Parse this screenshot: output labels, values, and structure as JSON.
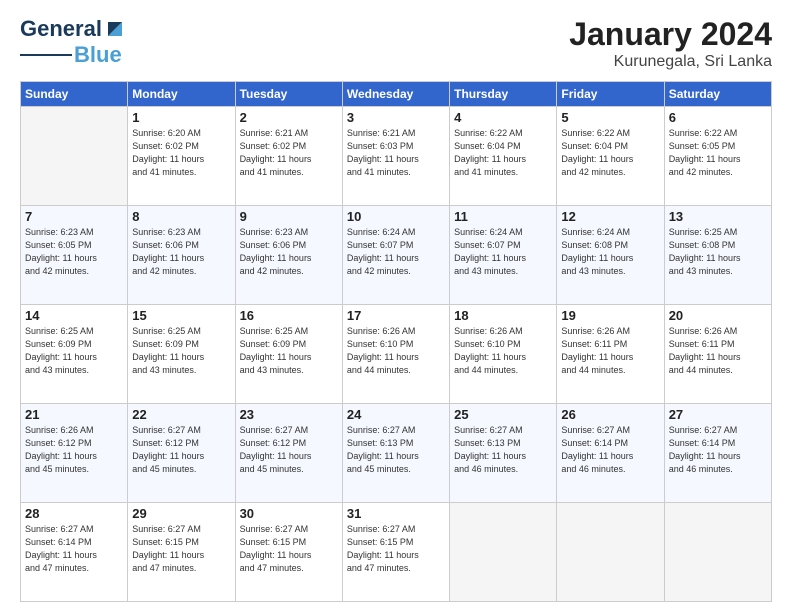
{
  "logo": {
    "part1": "General",
    "part2": "Blue"
  },
  "title": "January 2024",
  "subtitle": "Kurunegala, Sri Lanka",
  "days_of_week": [
    "Sunday",
    "Monday",
    "Tuesday",
    "Wednesday",
    "Thursday",
    "Friday",
    "Saturday"
  ],
  "weeks": [
    [
      {
        "day": "",
        "sunrise": "",
        "sunset": "",
        "daylight": ""
      },
      {
        "day": "1",
        "sunrise": "Sunrise: 6:20 AM",
        "sunset": "Sunset: 6:02 PM",
        "daylight": "Daylight: 11 hours and 41 minutes."
      },
      {
        "day": "2",
        "sunrise": "Sunrise: 6:21 AM",
        "sunset": "Sunset: 6:02 PM",
        "daylight": "Daylight: 11 hours and 41 minutes."
      },
      {
        "day": "3",
        "sunrise": "Sunrise: 6:21 AM",
        "sunset": "Sunset: 6:03 PM",
        "daylight": "Daylight: 11 hours and 41 minutes."
      },
      {
        "day": "4",
        "sunrise": "Sunrise: 6:22 AM",
        "sunset": "Sunset: 6:04 PM",
        "daylight": "Daylight: 11 hours and 41 minutes."
      },
      {
        "day": "5",
        "sunrise": "Sunrise: 6:22 AM",
        "sunset": "Sunset: 6:04 PM",
        "daylight": "Daylight: 11 hours and 42 minutes."
      },
      {
        "day": "6",
        "sunrise": "Sunrise: 6:22 AM",
        "sunset": "Sunset: 6:05 PM",
        "daylight": "Daylight: 11 hours and 42 minutes."
      }
    ],
    [
      {
        "day": "7",
        "sunrise": "Sunrise: 6:23 AM",
        "sunset": "Sunset: 6:05 PM",
        "daylight": "Daylight: 11 hours and 42 minutes."
      },
      {
        "day": "8",
        "sunrise": "Sunrise: 6:23 AM",
        "sunset": "Sunset: 6:06 PM",
        "daylight": "Daylight: 11 hours and 42 minutes."
      },
      {
        "day": "9",
        "sunrise": "Sunrise: 6:23 AM",
        "sunset": "Sunset: 6:06 PM",
        "daylight": "Daylight: 11 hours and 42 minutes."
      },
      {
        "day": "10",
        "sunrise": "Sunrise: 6:24 AM",
        "sunset": "Sunset: 6:07 PM",
        "daylight": "Daylight: 11 hours and 42 minutes."
      },
      {
        "day": "11",
        "sunrise": "Sunrise: 6:24 AM",
        "sunset": "Sunset: 6:07 PM",
        "daylight": "Daylight: 11 hours and 43 minutes."
      },
      {
        "day": "12",
        "sunrise": "Sunrise: 6:24 AM",
        "sunset": "Sunset: 6:08 PM",
        "daylight": "Daylight: 11 hours and 43 minutes."
      },
      {
        "day": "13",
        "sunrise": "Sunrise: 6:25 AM",
        "sunset": "Sunset: 6:08 PM",
        "daylight": "Daylight: 11 hours and 43 minutes."
      }
    ],
    [
      {
        "day": "14",
        "sunrise": "Sunrise: 6:25 AM",
        "sunset": "Sunset: 6:09 PM",
        "daylight": "Daylight: 11 hours and 43 minutes."
      },
      {
        "day": "15",
        "sunrise": "Sunrise: 6:25 AM",
        "sunset": "Sunset: 6:09 PM",
        "daylight": "Daylight: 11 hours and 43 minutes."
      },
      {
        "day": "16",
        "sunrise": "Sunrise: 6:25 AM",
        "sunset": "Sunset: 6:09 PM",
        "daylight": "Daylight: 11 hours and 43 minutes."
      },
      {
        "day": "17",
        "sunrise": "Sunrise: 6:26 AM",
        "sunset": "Sunset: 6:10 PM",
        "daylight": "Daylight: 11 hours and 44 minutes."
      },
      {
        "day": "18",
        "sunrise": "Sunrise: 6:26 AM",
        "sunset": "Sunset: 6:10 PM",
        "daylight": "Daylight: 11 hours and 44 minutes."
      },
      {
        "day": "19",
        "sunrise": "Sunrise: 6:26 AM",
        "sunset": "Sunset: 6:11 PM",
        "daylight": "Daylight: 11 hours and 44 minutes."
      },
      {
        "day": "20",
        "sunrise": "Sunrise: 6:26 AM",
        "sunset": "Sunset: 6:11 PM",
        "daylight": "Daylight: 11 hours and 44 minutes."
      }
    ],
    [
      {
        "day": "21",
        "sunrise": "Sunrise: 6:26 AM",
        "sunset": "Sunset: 6:12 PM",
        "daylight": "Daylight: 11 hours and 45 minutes."
      },
      {
        "day": "22",
        "sunrise": "Sunrise: 6:27 AM",
        "sunset": "Sunset: 6:12 PM",
        "daylight": "Daylight: 11 hours and 45 minutes."
      },
      {
        "day": "23",
        "sunrise": "Sunrise: 6:27 AM",
        "sunset": "Sunset: 6:12 PM",
        "daylight": "Daylight: 11 hours and 45 minutes."
      },
      {
        "day": "24",
        "sunrise": "Sunrise: 6:27 AM",
        "sunset": "Sunset: 6:13 PM",
        "daylight": "Daylight: 11 hours and 45 minutes."
      },
      {
        "day": "25",
        "sunrise": "Sunrise: 6:27 AM",
        "sunset": "Sunset: 6:13 PM",
        "daylight": "Daylight: 11 hours and 46 minutes."
      },
      {
        "day": "26",
        "sunrise": "Sunrise: 6:27 AM",
        "sunset": "Sunset: 6:14 PM",
        "daylight": "Daylight: 11 hours and 46 minutes."
      },
      {
        "day": "27",
        "sunrise": "Sunrise: 6:27 AM",
        "sunset": "Sunset: 6:14 PM",
        "daylight": "Daylight: 11 hours and 46 minutes."
      }
    ],
    [
      {
        "day": "28",
        "sunrise": "Sunrise: 6:27 AM",
        "sunset": "Sunset: 6:14 PM",
        "daylight": "Daylight: 11 hours and 47 minutes."
      },
      {
        "day": "29",
        "sunrise": "Sunrise: 6:27 AM",
        "sunset": "Sunset: 6:15 PM",
        "daylight": "Daylight: 11 hours and 47 minutes."
      },
      {
        "day": "30",
        "sunrise": "Sunrise: 6:27 AM",
        "sunset": "Sunset: 6:15 PM",
        "daylight": "Daylight: 11 hours and 47 minutes."
      },
      {
        "day": "31",
        "sunrise": "Sunrise: 6:27 AM",
        "sunset": "Sunset: 6:15 PM",
        "daylight": "Daylight: 11 hours and 47 minutes."
      },
      {
        "day": "",
        "sunrise": "",
        "sunset": "",
        "daylight": ""
      },
      {
        "day": "",
        "sunrise": "",
        "sunset": "",
        "daylight": ""
      },
      {
        "day": "",
        "sunrise": "",
        "sunset": "",
        "daylight": ""
      }
    ]
  ]
}
